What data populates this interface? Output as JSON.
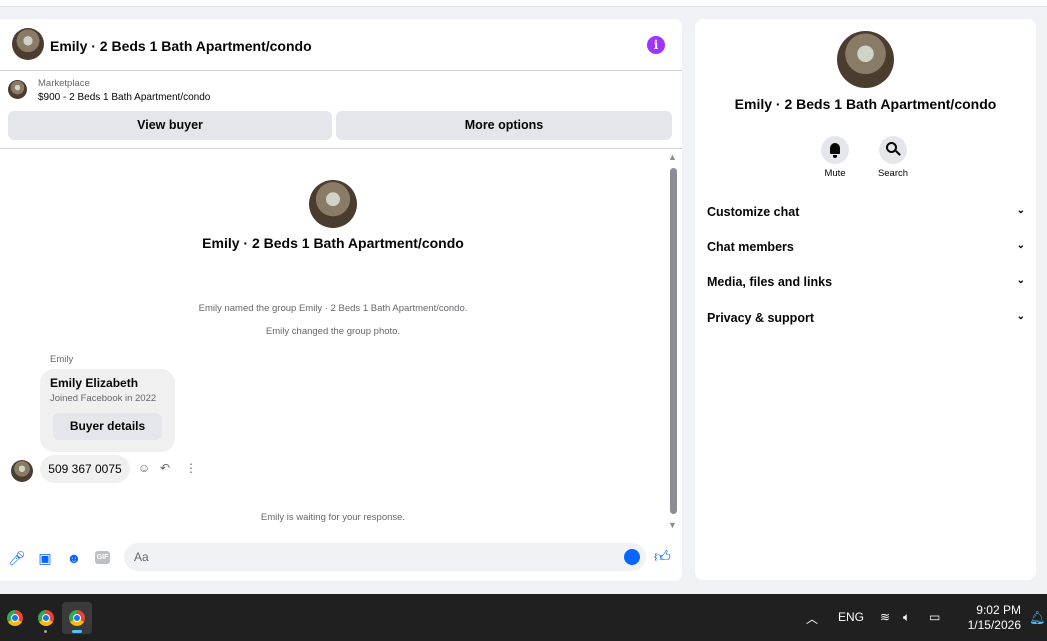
{
  "chat": {
    "title": "Emily · 2 Beds 1 Bath Apartment/condo",
    "info_icon": "i",
    "marketplace_label": "Marketplace",
    "listing": "$900 - 2 Beds 1 Bath Apartment/condo",
    "view_buyer": "View buyer",
    "more_options": "More options",
    "center_title": "Emily · 2 Beds 1 Bath Apartment/condo",
    "system_messages": [
      "Emily named the group Emily · 2 Beds 1 Bath Apartment/condo.",
      "Emily changed the group photo.",
      "Emily is waiting for your response."
    ],
    "sender_name": "Emily",
    "card": {
      "name": "Emily Elizabeth",
      "subtitle": "Joined Facebook in 2022",
      "button": "Buyer details"
    },
    "message": "509 367 0075",
    "composer_placeholder": "Aa",
    "gif_label": "GIF"
  },
  "sidebar": {
    "title": "Emily · 2 Beds 1 Bath Apartment/condo",
    "actions": [
      {
        "label": "Mute",
        "icon": "bell-icon"
      },
      {
        "label": "Search",
        "icon": "search-icon"
      }
    ],
    "sections": [
      "Customize chat",
      "Chat members",
      "Media, files and links",
      "Privacy & support"
    ]
  },
  "taskbar": {
    "language": "ENG",
    "time": "9:02 PM",
    "date": "1/15/2026"
  },
  "colors": {
    "accent": "#0866ff",
    "info": "#a033ff",
    "taskbar": "#202020"
  }
}
